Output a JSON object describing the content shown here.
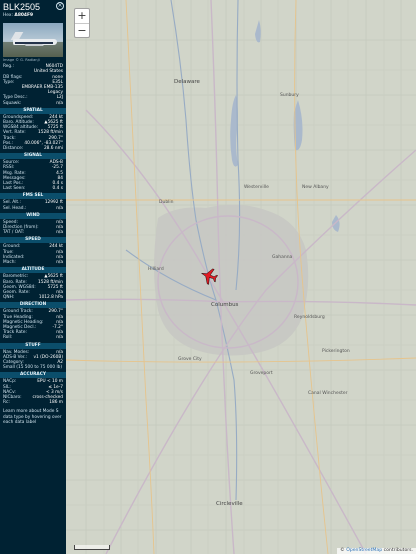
{
  "aircraft": {
    "callsign": "BLK2505",
    "hex_label": "Hex:",
    "hex": "A804F9",
    "close_icon": "×",
    "photo_credit": "Image © G. Radianji"
  },
  "info_rows": [
    {
      "k": "Reg.:",
      "v": "N604TD"
    },
    {
      "k": "",
      "v": "United States"
    },
    {
      "k": "DB flags:",
      "v": "none"
    },
    {
      "k": "Type:",
      "v": "E35L"
    },
    {
      "k": "",
      "v": "EMBRAER EMB-135"
    },
    {
      "k": "",
      "v": "Legacy"
    },
    {
      "k": "Type Desc.:",
      "v": "L2J"
    },
    {
      "k": "Squawk:",
      "v": "n/a"
    }
  ],
  "sections": [
    {
      "title": "SPATIAL",
      "rows": [
        {
          "k": "Groundspeed:",
          "v": "244 kt"
        },
        {
          "k": "Baro. Altitude:",
          "v": "▲5625 ft"
        },
        {
          "k": "WGS84 altitude:",
          "v": "5725 ft"
        },
        {
          "k": "Vert. Rate:",
          "v": "1528 ft/min"
        },
        {
          "k": "Track:",
          "v": "290.7°"
        },
        {
          "k": "Pos.:",
          "v": "40.006°, -83.027°"
        },
        {
          "k": "Distance:",
          "v": "28.6 nmi"
        }
      ]
    },
    {
      "title": "SIGNAL",
      "rows": [
        {
          "k": "Source:",
          "v": "ADS-B"
        },
        {
          "k": "RSSI:",
          "v": "-25.7"
        },
        {
          "k": "Msg. Rate:",
          "v": "4.5"
        },
        {
          "k": "Messages:",
          "v": "84"
        },
        {
          "k": "Last Pos.:",
          "v": "0.4 s"
        },
        {
          "k": "Last Seen:",
          "v": "0.4 s"
        }
      ]
    },
    {
      "title": "FMS SEL",
      "rows": [
        {
          "k": "Sel. Alt.:",
          "v": "12992 ft"
        },
        {
          "k": "Sel. Head.:",
          "v": "n/a"
        }
      ]
    },
    {
      "title": "WIND",
      "rows": [
        {
          "k": "Speed:",
          "v": "n/a"
        },
        {
          "k": "Direction (from):",
          "v": "n/a"
        },
        {
          "k": "TAT / OAT:",
          "v": "n/a"
        }
      ]
    },
    {
      "title": "SPEED",
      "rows": [
        {
          "k": "Ground:",
          "v": "244 kt"
        },
        {
          "k": "True:",
          "v": "n/a"
        },
        {
          "k": "Indicated:",
          "v": "n/a"
        },
        {
          "k": "Mach:",
          "v": "n/a"
        }
      ]
    },
    {
      "title": "ALTITUDE",
      "rows": [
        {
          "k": "Barometric:",
          "v": "▲5625 ft"
        },
        {
          "k": "Baro. Rate:",
          "v": "1528 ft/min"
        },
        {
          "k": "Geom. WGS84:",
          "v": "5725 ft"
        },
        {
          "k": "Geom. Rate:",
          "v": "n/a"
        },
        {
          "k": "QNH:",
          "v": "1012.8 hPa"
        }
      ]
    },
    {
      "title": "DIRECTION",
      "rows": [
        {
          "k": "Ground Track:",
          "v": "290.7°"
        },
        {
          "k": "True Heading:",
          "v": "n/a"
        },
        {
          "k": "Magnetic Heading:",
          "v": "n/a"
        },
        {
          "k": "Magnetic Decl.:",
          "v": "-7.2°"
        },
        {
          "k": "Track Rate:",
          "v": "n/a"
        },
        {
          "k": "Roll:",
          "v": "n/a"
        }
      ]
    },
    {
      "title": "STUFF",
      "rows": [
        {
          "k": "Nav. Modes:",
          "v": "n/a"
        },
        {
          "k": "ADS-B Ver.:",
          "v": "v1 (DO-260B)"
        },
        {
          "k": "Category:",
          "v": "A2"
        },
        {
          "k": "Small (15 500 to 75 000 lb)",
          "v": ""
        }
      ]
    },
    {
      "title": "ACCURACY",
      "rows": [
        {
          "k": "NACp:",
          "v": "EPU < 10 m"
        },
        {
          "k": "SIL:",
          "v": "≤ 1e-7"
        },
        {
          "k": "NACv:",
          "v": "< 3 m/s"
        },
        {
          "k": "NICbaro:",
          "v": "cross-checked"
        },
        {
          "k": "Rc:",
          "v": "186 m"
        }
      ]
    }
  ],
  "footer_note": "Learn more about Mode S data type by hovering over each data label",
  "map": {
    "zoom_in": "+",
    "zoom_out": "−",
    "attribution_prefix": "© ",
    "attribution_osm": "OpenStreetMap",
    "attribution_suffix": " contributors.",
    "aircraft_color": "#e01b24",
    "places": [
      {
        "name": "Delaware"
      },
      {
        "name": "Sunbury"
      },
      {
        "name": "Westerville"
      },
      {
        "name": "Dublin"
      },
      {
        "name": "New Albany"
      },
      {
        "name": "Hilliard"
      },
      {
        "name": "Gahanna"
      },
      {
        "name": "Columbus"
      },
      {
        "name": "Reynoldsburg"
      },
      {
        "name": "Grove City"
      },
      {
        "name": "Groveport"
      },
      {
        "name": "Pickerington"
      },
      {
        "name": "Canal Winchester"
      },
      {
        "name": "Circleville"
      }
    ]
  }
}
